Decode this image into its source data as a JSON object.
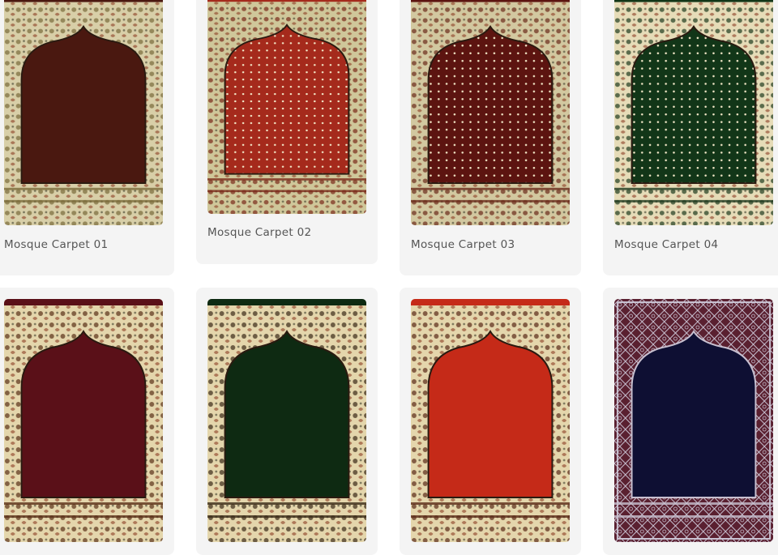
{
  "products": [
    {
      "title": "Mosque Carpet 01",
      "field_color": "#4a1810",
      "border_color": "#d8cfa8",
      "accent_color": "#7a6a3a",
      "pattern": "floral-arch",
      "dots": false
    },
    {
      "title": "Mosque Carpet 02",
      "field_color": "#a52a1c",
      "border_color": "#cfc79a",
      "accent_color": "#7a2a1a",
      "pattern": "dotted-arch",
      "dots": true
    },
    {
      "title": "Mosque Carpet 03",
      "field_color": "#5c1410",
      "border_color": "#d2c8a0",
      "accent_color": "#6a2a1a",
      "pattern": "dotted-arch",
      "dots": true
    },
    {
      "title": "Mosque Carpet 04",
      "field_color": "#123618",
      "border_color": "#e6dcb8",
      "accent_color": "#1e3a1e",
      "pattern": "dotted-arch",
      "dots": true
    },
    {
      "title": "",
      "field_color": "#5a1018",
      "border_color": "#e4d6ac",
      "accent_color": "#5a3018",
      "pattern": "floral-arch",
      "dots": false
    },
    {
      "title": "",
      "field_color": "#0e2a12",
      "border_color": "#e4d6ac",
      "accent_color": "#3a2a18",
      "pattern": "floral-arch",
      "dots": false
    },
    {
      "title": "",
      "field_color": "#c52a18",
      "border_color": "#e4d6ac",
      "accent_color": "#5a2a18",
      "pattern": "floral-arch",
      "dots": false
    },
    {
      "title": "",
      "field_color": "#0e0f33",
      "border_color": "#5a2030",
      "accent_color": "#c8c0d0",
      "pattern": "geometric-arch",
      "dots": false
    }
  ]
}
